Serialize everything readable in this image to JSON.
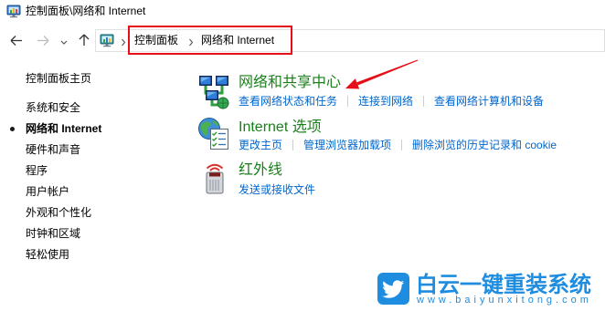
{
  "window": {
    "title": "控制面板\\网络和 Internet",
    "icon": "control-panel-icon"
  },
  "navigation": {
    "back_icon": "back-arrow-icon",
    "forward_icon": "forward-arrow-icon",
    "forward_enabled": false,
    "recent_icon": "chevron-down-icon",
    "up_icon": "up-arrow-icon",
    "address_icon": "control-panel-icon",
    "separator_icon": "chevron-right-icon",
    "breadcrumb": [
      "控制面板",
      "网络和 Internet"
    ]
  },
  "sidebar": {
    "home": "控制面板主页",
    "items": [
      {
        "label": "系统和安全",
        "active": false
      },
      {
        "label": "网络和 Internet",
        "active": true
      },
      {
        "label": "硬件和声音",
        "active": false
      },
      {
        "label": "程序",
        "active": false
      },
      {
        "label": "用户帐户",
        "active": false
      },
      {
        "label": "外观和个性化",
        "active": false
      },
      {
        "label": "时钟和区域",
        "active": false
      },
      {
        "label": "轻松使用",
        "active": false
      }
    ]
  },
  "categories": [
    {
      "icon": "network-sharing-icon",
      "title": "网络和共享中心",
      "links": [
        "查看网络状态和任务",
        "连接到网络",
        "查看网络计算机和设备"
      ]
    },
    {
      "icon": "internet-options-icon",
      "title": "Internet 选项",
      "links": [
        "更改主页",
        "管理浏览器加载项",
        "删除浏览的历史记录和 cookie"
      ]
    },
    {
      "icon": "infrared-icon",
      "title": "红外线",
      "links": [
        "发送或接收文件"
      ]
    }
  ],
  "annotation": {
    "box_icon": "highlight-box",
    "arrow_icon": "red-arrow-icon"
  },
  "watermark": {
    "logo_icon": "bird-icon",
    "brand": "白云一键重装系统",
    "url": "www.baiyunxitong.com"
  },
  "colors": {
    "category-title": "#1a7f1a",
    "link": "#0066cc",
    "annotation-red": "#e60f19",
    "watermark-blue": "#1f8ddf"
  }
}
